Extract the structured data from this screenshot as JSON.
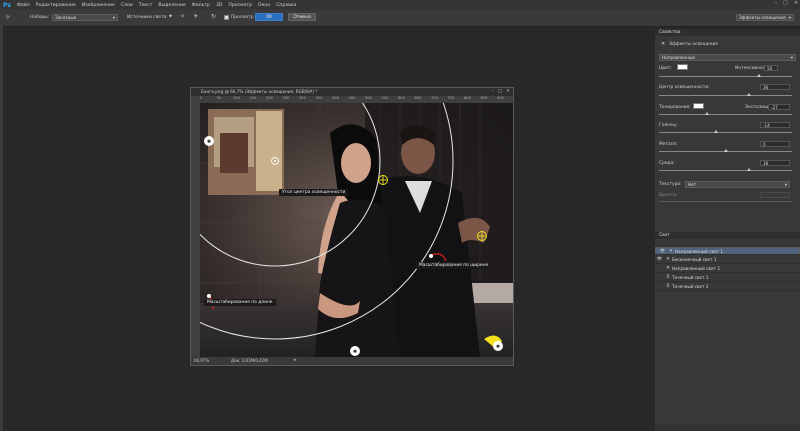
{
  "app": {
    "logo": "Ps"
  },
  "menu": [
    "Файл",
    "Редактирование",
    "Изображение",
    "Слои",
    "Текст",
    "Выделение",
    "Фильтр",
    "3D",
    "Просмотр",
    "Окно",
    "Справка"
  ],
  "window_controls": [
    "–",
    "□",
    "✕"
  ],
  "options": {
    "presets_label": "Наборы:",
    "presets_value": "Заказные",
    "light_sources_label": "Источники света:",
    "preview_label": "Просмотр",
    "ok_label": "OK",
    "cancel_label": "Отмена",
    "workspace_value": "Эффекты освещения"
  },
  "document": {
    "title": "Банго.png @ 66,7% (Эффекты освещения, RGB/8#) *",
    "ruler_marks": [
      "0",
      "50",
      "100",
      "150",
      "200",
      "250",
      "300",
      "350",
      "400",
      "450",
      "500",
      "550",
      "600",
      "650",
      "700",
      "750",
      "800",
      "850",
      "900"
    ],
    "zoom": "66,67%",
    "doc_size": "Док: 2,81M/0,42M"
  },
  "canvas_labels": {
    "center_angle": "Угол центра освещенности",
    "scale_width": "Масштабирование по ширине",
    "scale_length": "Масштабирование по длине"
  },
  "properties": {
    "tab": "Свойства",
    "header": "Эффекты освещения",
    "light_type": "Направленный",
    "color_label": "Цвет:",
    "intensity_label": "Интенсивность:",
    "intensity_value": "50",
    "intensity_level": 0.75,
    "hotspot_label": "Центр освещенности:",
    "hotspot_value": "36",
    "hotspot_level": 0.68,
    "colorize_label": "Тонирование:",
    "exposure_label": "Экспозиция:",
    "exposure_value": "-27",
    "exposure_level": 0.36,
    "gloss_label": "Глянец:",
    "gloss_value": "-14",
    "gloss_level": 0.43,
    "metallic_label": "Металл:",
    "metallic_value": "0",
    "metallic_level": 0.5,
    "ambience_label": "Среда:",
    "ambience_value": "36",
    "ambience_level": 0.68,
    "texture_label": "Текстура:",
    "texture_value": "Нет",
    "height_label": "Высота:"
  },
  "lights": {
    "tab": "Свет",
    "items": [
      {
        "label": "Направленный свет 1",
        "visible": true,
        "selected": true
      },
      {
        "label": "Бесконечный свет 1",
        "visible": true,
        "selected": false
      },
      {
        "label": "Направленный свет 2",
        "visible": false,
        "selected": false
      },
      {
        "label": "Точечный свет 1",
        "visible": false,
        "selected": false
      },
      {
        "label": "Точечный свет 2",
        "visible": false,
        "selected": false
      }
    ]
  },
  "colors": {
    "accent": "#2b6fbf",
    "selection": "#51637a",
    "tool_yellow": "#f0e020",
    "handle_red": "#d02020"
  }
}
